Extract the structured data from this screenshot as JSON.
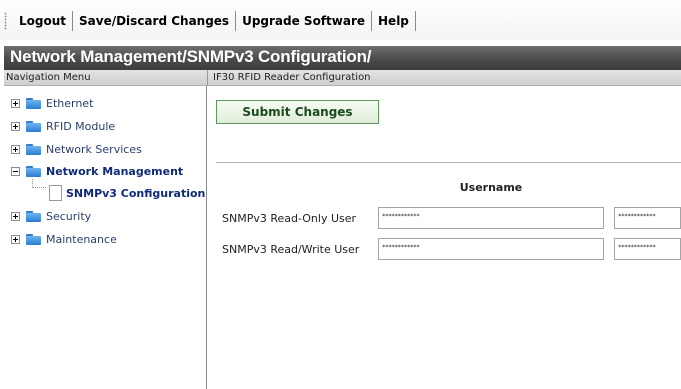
{
  "toolbar": {
    "logout": "Logout",
    "save_discard": "Save/Discard Changes",
    "upgrade": "Upgrade Software",
    "help": "Help"
  },
  "title": "Network Management/SNMPv3 Configuration/",
  "headers": {
    "nav": "Navigation Menu",
    "content": "IF30 RFID Reader Configuration"
  },
  "nav": {
    "items": [
      {
        "label": "Ethernet"
      },
      {
        "label": "RFID Module"
      },
      {
        "label": "Network Services"
      },
      {
        "label": "Network Management"
      },
      {
        "label": "SNMPv3 Configuration"
      },
      {
        "label": "Security"
      },
      {
        "label": "Maintenance"
      }
    ]
  },
  "content": {
    "submit_label": "Submit Changes",
    "username_header": "Username",
    "rows": [
      {
        "label": "SNMPv3 Read-Only User",
        "username": "************",
        "second": "************"
      },
      {
        "label": "SNMPv3 Read/Write User",
        "username": "************",
        "second": "************"
      }
    ]
  },
  "colors": {
    "title_bg": "#4a4a4a",
    "nav_text": "#2a3f6b",
    "active_text": "#102a7a",
    "submit_border": "#5c9a5c",
    "folder": "#2a7cd0"
  },
  "icons": {
    "folder": "folder-icon",
    "expander": "tree-expander-icon",
    "page": "page-icon"
  }
}
